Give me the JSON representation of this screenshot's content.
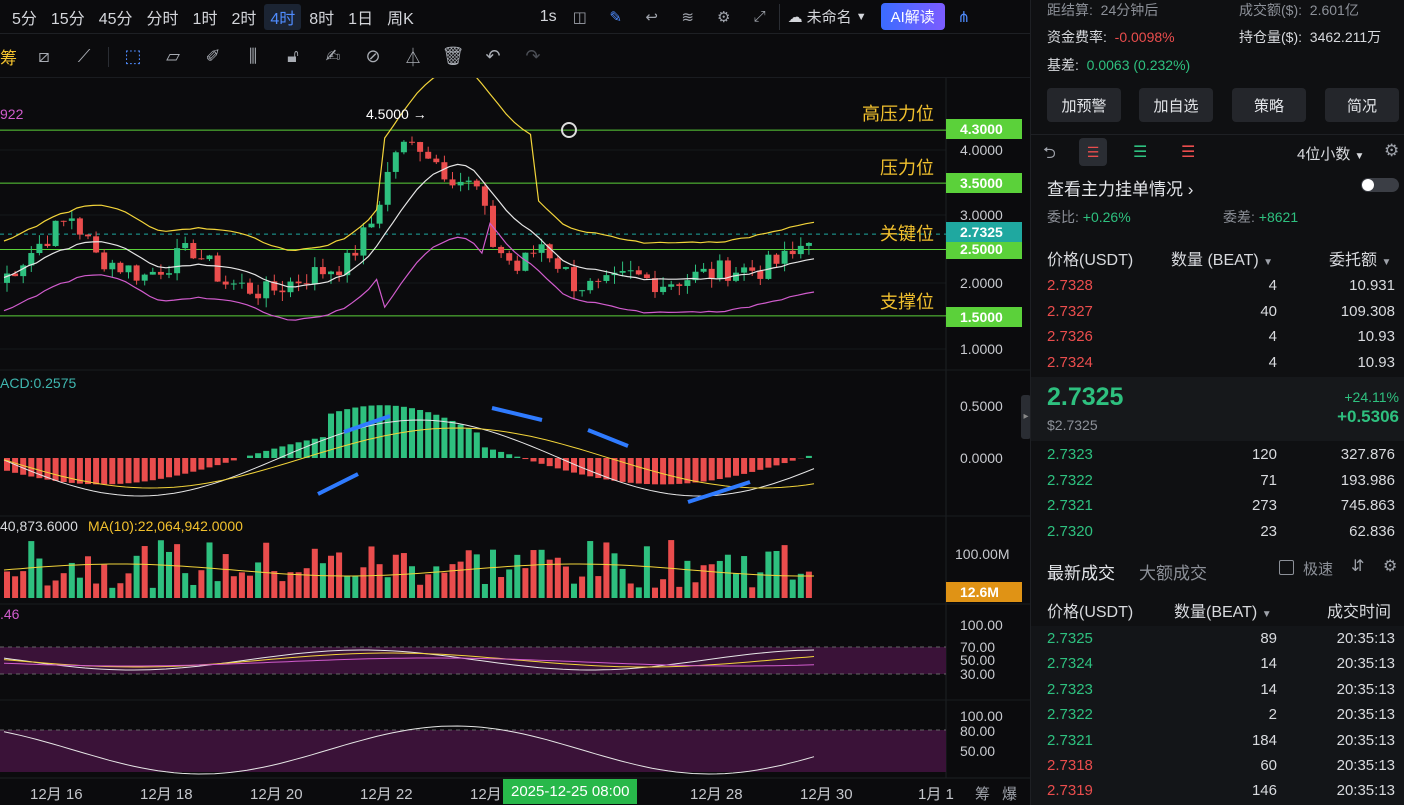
{
  "toolbar": {
    "timeframes": [
      "5分",
      "15分",
      "45分",
      "分时",
      "1时",
      "2时",
      "4时",
      "8时",
      "1日",
      "周K"
    ],
    "active_timeframe": "4时",
    "interval": "1s",
    "layout_name": "未命名",
    "ai_button": "AI解读"
  },
  "draw_tools_first": "筹",
  "price_axis": [
    "4.0000",
    "3.0000",
    "2.0000",
    "1.0000"
  ],
  "level_lines": [
    {
      "label": "高压力位",
      "value": "4.3000"
    },
    {
      "label": "压力位",
      "value": "3.5000"
    },
    {
      "label": "关键位",
      "value": "2.5000"
    },
    {
      "label": "支撑位",
      "value": "1.5000"
    }
  ],
  "current_price_tag": "2.7325",
  "peak_annotation": "4.5000",
  "boll_label": "922",
  "macd": {
    "label": "ACD:0.2575",
    "axis": [
      "0.5000",
      "0.0000"
    ]
  },
  "volume": {
    "label": "40,873.6000",
    "ma_label": "MA(10):22,064,942.0000",
    "axis": "100.00M",
    "current": "12.6M"
  },
  "rsi": {
    "label": ".46",
    "axis": [
      "100.00",
      "70.00",
      "50.00",
      "30.00"
    ]
  },
  "kdj": {
    "axis": [
      "100.00",
      "80.00",
      "50.00"
    ]
  },
  "xaxis": [
    "12月 16",
    "12月 18",
    "12月 20",
    "12月 22",
    "12月",
    "12月 28",
    "12月 30",
    "1月 1"
  ],
  "date_chip": "2025-12-25 08:00",
  "bottom_right": [
    "筹",
    "爆"
  ],
  "colors": {
    "up": "#2ec07f",
    "down": "#ea4d4d",
    "accent": "#4f8cff",
    "level": "#5bd13a",
    "label": "#f2c12e"
  },
  "right": {
    "settle_label": "距结算:",
    "settle_value": "24分钟后",
    "turnover_label": "成交额($):",
    "turnover_value": "2.601亿",
    "funding_label": "资金费率:",
    "funding_value": "-0.0098%",
    "oi_label": "持仓量($):",
    "oi_value": "3462.211万",
    "basis_label": "基差:",
    "basis_value": "0.0063 (0.232%)",
    "buttons": [
      "加预警",
      "加自选",
      "策略",
      "简况"
    ],
    "decimals": "4位小数",
    "orders_link": "查看主力挂单情况",
    "ratio_label": "委比:",
    "ratio_value": "+0.26%",
    "diff_label": "委差:",
    "diff_value": "+8621",
    "ob_headers": [
      "价格(USDT)",
      "数量 (BEAT)",
      "委托额"
    ],
    "asks": [
      {
        "p": "2.7328",
        "q": "4",
        "t": "10.931"
      },
      {
        "p": "2.7327",
        "q": "40",
        "t": "109.308"
      },
      {
        "p": "2.7326",
        "q": "4",
        "t": "10.93"
      },
      {
        "p": "2.7324",
        "q": "4",
        "t": "10.93"
      }
    ],
    "last_price": "2.7325",
    "last_usd": "$2.7325",
    "change_pct": "+24.11%",
    "change_abs": "+0.5306",
    "bids": [
      {
        "p": "2.7323",
        "q": "120",
        "t": "327.876"
      },
      {
        "p": "2.7322",
        "q": "71",
        "t": "193.986"
      },
      {
        "p": "2.7321",
        "q": "273",
        "t": "745.863"
      },
      {
        "p": "2.7320",
        "q": "23",
        "t": "62.836"
      }
    ],
    "trade_tabs": [
      "最新成交",
      "大额成交"
    ],
    "fast_label": "极速",
    "trade_headers": [
      "价格(USDT)",
      "数量(BEAT)",
      "成交时间"
    ],
    "trades": [
      {
        "p": "2.7325",
        "q": "89",
        "t": "20:35:13",
        "side": "up"
      },
      {
        "p": "2.7324",
        "q": "14",
        "t": "20:35:13",
        "side": "up"
      },
      {
        "p": "2.7323",
        "q": "14",
        "t": "20:35:13",
        "side": "up"
      },
      {
        "p": "2.7322",
        "q": "2",
        "t": "20:35:13",
        "side": "up"
      },
      {
        "p": "2.7321",
        "q": "184",
        "t": "20:35:13",
        "side": "up"
      },
      {
        "p": "2.7318",
        "q": "60",
        "t": "20:35:13",
        "side": "down"
      },
      {
        "p": "2.7319",
        "q": "146",
        "t": "20:35:13",
        "side": "down"
      }
    ]
  }
}
